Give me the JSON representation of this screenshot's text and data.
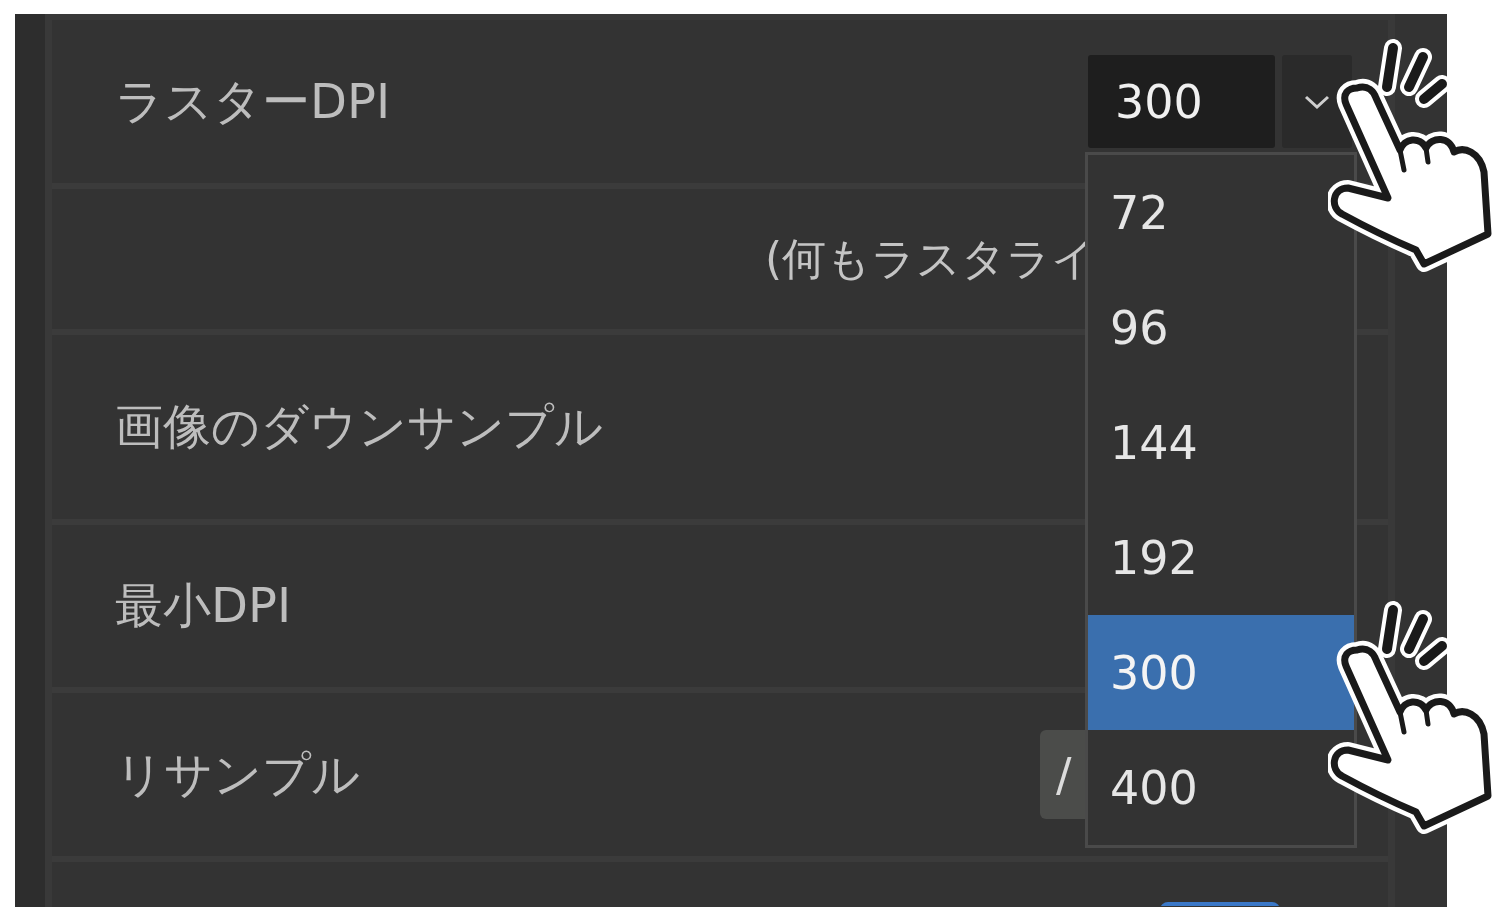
{
  "settings": {
    "rows": [
      {
        "kind": "dropdown",
        "label": "ラスターDPI",
        "value": "300",
        "expanded": true,
        "options": [
          {
            "label": "72",
            "selected": false
          },
          {
            "label": "96",
            "selected": false
          },
          {
            "label": "144",
            "selected": false
          },
          {
            "label": "192",
            "selected": false
          },
          {
            "label": "300",
            "selected": true
          },
          {
            "label": "400",
            "selected": false
          }
        ]
      },
      {
        "kind": "note",
        "text": "(何もラスタライ"
      },
      {
        "kind": "heading",
        "label": "画像のダウンサンプル"
      },
      {
        "kind": "heading",
        "label": "最小DPI"
      },
      {
        "kind": "button",
        "label": "リサンプル",
        "button": "/"
      },
      {
        "kind": "cut_off_button"
      }
    ]
  }
}
